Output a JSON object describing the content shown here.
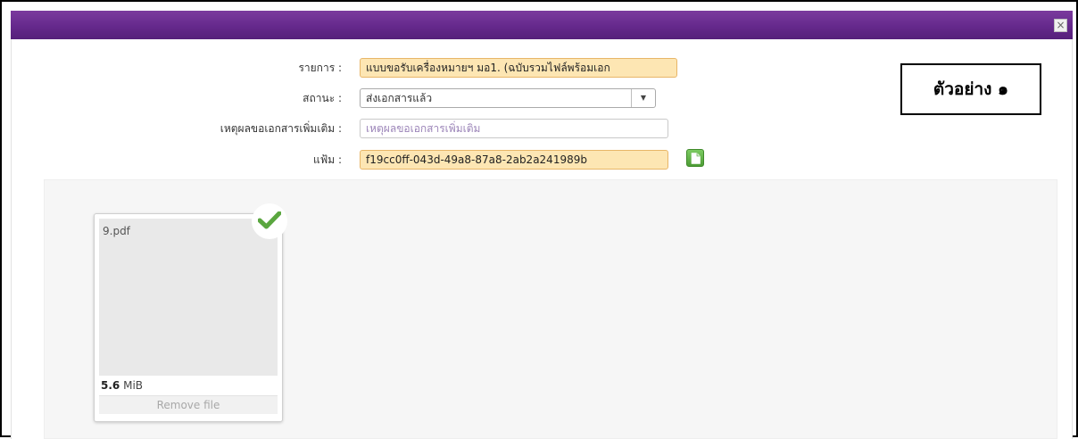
{
  "dialog": {
    "close_glyph": "×",
    "accent_color": "#65298c"
  },
  "form": {
    "item_label": "รายการ :",
    "item_value": "แบบขอรับเครื่องหมายฯ มอ1. (ฉบับรวมไฟล์พร้อมเอก",
    "status_label": "สถานะ :",
    "status_selected": "ส่งเอกสารแล้ว",
    "reason_label": "เหตุผลขอเอกสารเพิ่มเติม :",
    "reason_placeholder": "เหตุผลขอเอกสารเพิ่มเติม",
    "file_label": "แฟ้ม :",
    "file_value": "f19cc0ff-043d-49a8-87a8-2ab2a241989b",
    "file_button_icon": "document-icon"
  },
  "annotation": {
    "example_label": "ตัวอย่าง ๑"
  },
  "upload": {
    "file_name": "9.pdf",
    "file_size_value": "5.6",
    "file_size_unit": "MiB",
    "remove_label": "Remove file",
    "status_icon": "checkmark-icon",
    "success_color": "#5aa63f"
  }
}
